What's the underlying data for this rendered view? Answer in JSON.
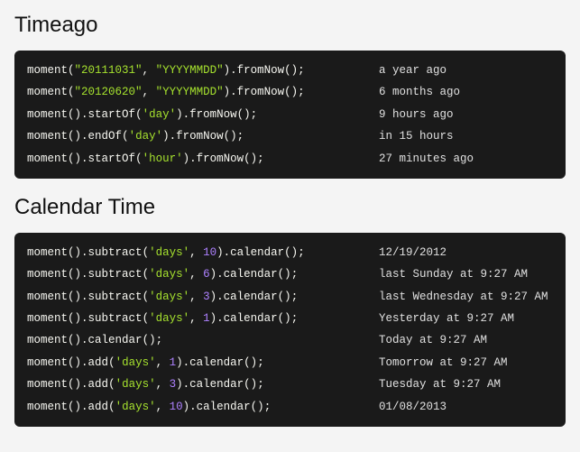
{
  "sections": [
    {
      "title": "Timeago",
      "rows": [
        {
          "tokens": [
            {
              "t": "fn",
              "v": "moment"
            },
            {
              "t": "paren",
              "v": "("
            },
            {
              "t": "str",
              "v": "\"20111031\""
            },
            {
              "t": "punc",
              "v": ", "
            },
            {
              "t": "str",
              "v": "\"YYYYMMDD\""
            },
            {
              "t": "paren",
              "v": ")"
            },
            {
              "t": "dot",
              "v": "."
            },
            {
              "t": "fn",
              "v": "fromNow"
            },
            {
              "t": "paren",
              "v": "()"
            },
            {
              "t": "punc",
              "v": ";"
            }
          ],
          "result": "a year ago"
        },
        {
          "tokens": [
            {
              "t": "fn",
              "v": "moment"
            },
            {
              "t": "paren",
              "v": "("
            },
            {
              "t": "str",
              "v": "\"20120620\""
            },
            {
              "t": "punc",
              "v": ", "
            },
            {
              "t": "str",
              "v": "\"YYYYMMDD\""
            },
            {
              "t": "paren",
              "v": ")"
            },
            {
              "t": "dot",
              "v": "."
            },
            {
              "t": "fn",
              "v": "fromNow"
            },
            {
              "t": "paren",
              "v": "()"
            },
            {
              "t": "punc",
              "v": ";"
            }
          ],
          "result": "6 months ago"
        },
        {
          "tokens": [
            {
              "t": "fn",
              "v": "moment"
            },
            {
              "t": "paren",
              "v": "()"
            },
            {
              "t": "dot",
              "v": "."
            },
            {
              "t": "fn",
              "v": "startOf"
            },
            {
              "t": "paren",
              "v": "("
            },
            {
              "t": "str",
              "v": "'day'"
            },
            {
              "t": "paren",
              "v": ")"
            },
            {
              "t": "dot",
              "v": "."
            },
            {
              "t": "fn",
              "v": "fromNow"
            },
            {
              "t": "paren",
              "v": "()"
            },
            {
              "t": "punc",
              "v": ";"
            }
          ],
          "result": "9 hours ago"
        },
        {
          "tokens": [
            {
              "t": "fn",
              "v": "moment"
            },
            {
              "t": "paren",
              "v": "()"
            },
            {
              "t": "dot",
              "v": "."
            },
            {
              "t": "fn",
              "v": "endOf"
            },
            {
              "t": "paren",
              "v": "("
            },
            {
              "t": "str",
              "v": "'day'"
            },
            {
              "t": "paren",
              "v": ")"
            },
            {
              "t": "dot",
              "v": "."
            },
            {
              "t": "fn",
              "v": "fromNow"
            },
            {
              "t": "paren",
              "v": "()"
            },
            {
              "t": "punc",
              "v": ";"
            }
          ],
          "result": "in 15 hours"
        },
        {
          "tokens": [
            {
              "t": "fn",
              "v": "moment"
            },
            {
              "t": "paren",
              "v": "()"
            },
            {
              "t": "dot",
              "v": "."
            },
            {
              "t": "fn",
              "v": "startOf"
            },
            {
              "t": "paren",
              "v": "("
            },
            {
              "t": "str",
              "v": "'hour'"
            },
            {
              "t": "paren",
              "v": ")"
            },
            {
              "t": "dot",
              "v": "."
            },
            {
              "t": "fn",
              "v": "fromNow"
            },
            {
              "t": "paren",
              "v": "()"
            },
            {
              "t": "punc",
              "v": ";"
            }
          ],
          "result": "27 minutes ago"
        }
      ]
    },
    {
      "title": "Calendar Time",
      "rows": [
        {
          "tokens": [
            {
              "t": "fn",
              "v": "moment"
            },
            {
              "t": "paren",
              "v": "()"
            },
            {
              "t": "dot",
              "v": "."
            },
            {
              "t": "fn",
              "v": "subtract"
            },
            {
              "t": "paren",
              "v": "("
            },
            {
              "t": "str",
              "v": "'days'"
            },
            {
              "t": "punc",
              "v": ", "
            },
            {
              "t": "num",
              "v": "10"
            },
            {
              "t": "paren",
              "v": ")"
            },
            {
              "t": "dot",
              "v": "."
            },
            {
              "t": "fn",
              "v": "calendar"
            },
            {
              "t": "paren",
              "v": "()"
            },
            {
              "t": "punc",
              "v": ";"
            }
          ],
          "result": "12/19/2012"
        },
        {
          "tokens": [
            {
              "t": "fn",
              "v": "moment"
            },
            {
              "t": "paren",
              "v": "()"
            },
            {
              "t": "dot",
              "v": "."
            },
            {
              "t": "fn",
              "v": "subtract"
            },
            {
              "t": "paren",
              "v": "("
            },
            {
              "t": "str",
              "v": "'days'"
            },
            {
              "t": "punc",
              "v": ", "
            },
            {
              "t": "num",
              "v": "6"
            },
            {
              "t": "paren",
              "v": ")"
            },
            {
              "t": "dot",
              "v": "."
            },
            {
              "t": "fn",
              "v": "calendar"
            },
            {
              "t": "paren",
              "v": "()"
            },
            {
              "t": "punc",
              "v": ";"
            }
          ],
          "result": "last Sunday at 9:27 AM"
        },
        {
          "tokens": [
            {
              "t": "fn",
              "v": "moment"
            },
            {
              "t": "paren",
              "v": "()"
            },
            {
              "t": "dot",
              "v": "."
            },
            {
              "t": "fn",
              "v": "subtract"
            },
            {
              "t": "paren",
              "v": "("
            },
            {
              "t": "str",
              "v": "'days'"
            },
            {
              "t": "punc",
              "v": ", "
            },
            {
              "t": "num",
              "v": "3"
            },
            {
              "t": "paren",
              "v": ")"
            },
            {
              "t": "dot",
              "v": "."
            },
            {
              "t": "fn",
              "v": "calendar"
            },
            {
              "t": "paren",
              "v": "()"
            },
            {
              "t": "punc",
              "v": ";"
            }
          ],
          "result": "last Wednesday at 9:27 AM"
        },
        {
          "tokens": [
            {
              "t": "fn",
              "v": "moment"
            },
            {
              "t": "paren",
              "v": "()"
            },
            {
              "t": "dot",
              "v": "."
            },
            {
              "t": "fn",
              "v": "subtract"
            },
            {
              "t": "paren",
              "v": "("
            },
            {
              "t": "str",
              "v": "'days'"
            },
            {
              "t": "punc",
              "v": ", "
            },
            {
              "t": "num",
              "v": "1"
            },
            {
              "t": "paren",
              "v": ")"
            },
            {
              "t": "dot",
              "v": "."
            },
            {
              "t": "fn",
              "v": "calendar"
            },
            {
              "t": "paren",
              "v": "()"
            },
            {
              "t": "punc",
              "v": ";"
            }
          ],
          "result": "Yesterday at 9:27 AM"
        },
        {
          "tokens": [
            {
              "t": "fn",
              "v": "moment"
            },
            {
              "t": "paren",
              "v": "()"
            },
            {
              "t": "dot",
              "v": "."
            },
            {
              "t": "fn",
              "v": "calendar"
            },
            {
              "t": "paren",
              "v": "()"
            },
            {
              "t": "punc",
              "v": ";"
            }
          ],
          "result": "Today at 9:27 AM"
        },
        {
          "tokens": [
            {
              "t": "fn",
              "v": "moment"
            },
            {
              "t": "paren",
              "v": "()"
            },
            {
              "t": "dot",
              "v": "."
            },
            {
              "t": "fn",
              "v": "add"
            },
            {
              "t": "paren",
              "v": "("
            },
            {
              "t": "str",
              "v": "'days'"
            },
            {
              "t": "punc",
              "v": ", "
            },
            {
              "t": "num",
              "v": "1"
            },
            {
              "t": "paren",
              "v": ")"
            },
            {
              "t": "dot",
              "v": "."
            },
            {
              "t": "fn",
              "v": "calendar"
            },
            {
              "t": "paren",
              "v": "()"
            },
            {
              "t": "punc",
              "v": ";"
            }
          ],
          "result": "Tomorrow at 9:27 AM"
        },
        {
          "tokens": [
            {
              "t": "fn",
              "v": "moment"
            },
            {
              "t": "paren",
              "v": "()"
            },
            {
              "t": "dot",
              "v": "."
            },
            {
              "t": "fn",
              "v": "add"
            },
            {
              "t": "paren",
              "v": "("
            },
            {
              "t": "str",
              "v": "'days'"
            },
            {
              "t": "punc",
              "v": ", "
            },
            {
              "t": "num",
              "v": "3"
            },
            {
              "t": "paren",
              "v": ")"
            },
            {
              "t": "dot",
              "v": "."
            },
            {
              "t": "fn",
              "v": "calendar"
            },
            {
              "t": "paren",
              "v": "()"
            },
            {
              "t": "punc",
              "v": ";"
            }
          ],
          "result": "Tuesday at 9:27 AM"
        },
        {
          "tokens": [
            {
              "t": "fn",
              "v": "moment"
            },
            {
              "t": "paren",
              "v": "()"
            },
            {
              "t": "dot",
              "v": "."
            },
            {
              "t": "fn",
              "v": "add"
            },
            {
              "t": "paren",
              "v": "("
            },
            {
              "t": "str",
              "v": "'days'"
            },
            {
              "t": "punc",
              "v": ", "
            },
            {
              "t": "num",
              "v": "10"
            },
            {
              "t": "paren",
              "v": ")"
            },
            {
              "t": "dot",
              "v": "."
            },
            {
              "t": "fn",
              "v": "calendar"
            },
            {
              "t": "paren",
              "v": "()"
            },
            {
              "t": "punc",
              "v": ";"
            }
          ],
          "result": "01/08/2013"
        }
      ]
    }
  ]
}
